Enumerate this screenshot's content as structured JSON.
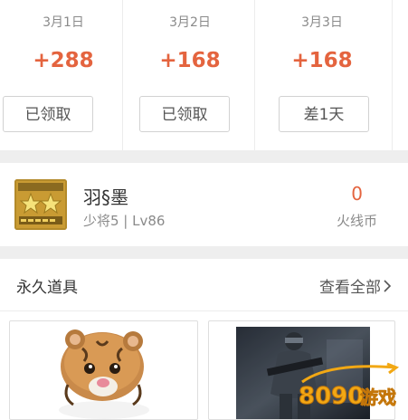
{
  "checkin": {
    "days": [
      {
        "date": "3月1日",
        "points": "+288",
        "button": "已领取"
      },
      {
        "date": "3月2日",
        "points": "+168",
        "button": "已领取"
      },
      {
        "date": "3月3日",
        "points": "+168",
        "button": "差1天"
      }
    ]
  },
  "profile": {
    "name": "羽§墨",
    "rank": "少将5 | Lv86",
    "coin_value": "0",
    "coin_label": "火线币"
  },
  "items": {
    "title": "永久道具",
    "view_all": "查看全部",
    "view_all_icon": "chevron-right-icon"
  },
  "colors": {
    "accent": "#e4643f",
    "text": "#333333",
    "muted": "#8a8a8a",
    "divider": "#eeeeee"
  }
}
